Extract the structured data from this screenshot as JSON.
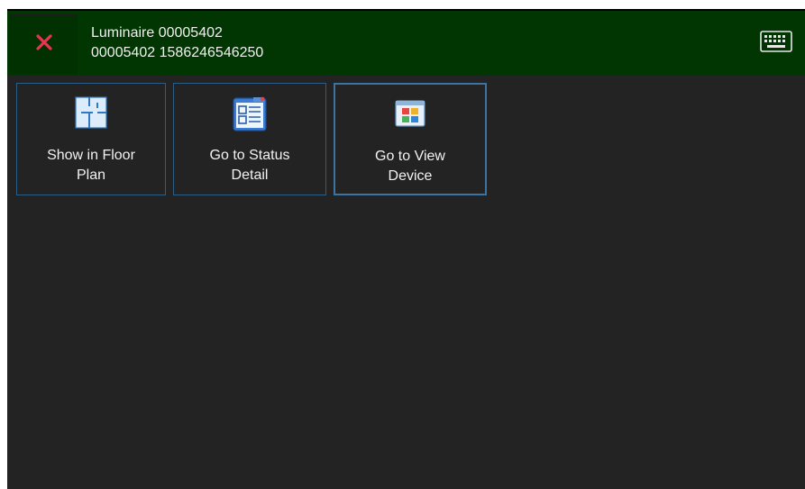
{
  "header": {
    "title": "Luminaire 00005402",
    "subtitle": "00005402 1586246546250",
    "close_icon": "close-icon",
    "keyboard_icon": "keyboard-icon"
  },
  "actions": [
    {
      "label": "Show in  Floor\nPlan",
      "icon": "floor-plan-icon"
    },
    {
      "label": "Go to Status\nDetail",
      "icon": "status-detail-icon"
    },
    {
      "label": "Go to View\nDevice",
      "icon": "view-device-icon"
    }
  ],
  "colors": {
    "header_bg": "#013501",
    "window_bg": "#232323",
    "close_red": "#e8344e",
    "button_border": "#2b5d85"
  }
}
